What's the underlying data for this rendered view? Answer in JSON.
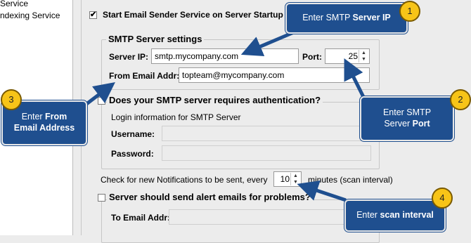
{
  "left_pane": {
    "items": [
      "Service",
      "ndexing Service"
    ]
  },
  "startup": {
    "checked": true,
    "label": "Start Email Sender Service on Server Startup"
  },
  "smtp_settings": {
    "legend": "SMTP Server settings",
    "server_ip_label": "Server IP:",
    "server_ip_value": "smtp.mycompany.com",
    "port_label": "Port:",
    "port_value": "25",
    "from_label": "From Email Addr:",
    "from_value": "topteam@mycompany.com"
  },
  "auth": {
    "checked": false,
    "label": "Does your SMTP server requires authentication?",
    "login_info": "Login information for SMTP Server",
    "username_label": "Username:",
    "username_value": "",
    "password_label": "Password:",
    "password_value": ""
  },
  "notifications": {
    "prefix": "Check for new Notifications to be sent, every",
    "interval_value": "10",
    "suffix": "minutes (scan interval)"
  },
  "alerts": {
    "checked": false,
    "label": "Server should send alert emails for problems?",
    "to_label": "To Email Addr:",
    "to_value": ""
  },
  "callouts": [
    {
      "number": "1",
      "text_plain": "Enter SMTP ",
      "text_bold": "Server IP"
    },
    {
      "number": "2",
      "line1": "Enter SMTP",
      "line2_plain": "Server ",
      "line2_bold": "Port"
    },
    {
      "number": "3",
      "line1_plain": "Enter ",
      "line1_bold": "From",
      "line2_bold": "Email Address"
    },
    {
      "number": "4",
      "text_plain": "Enter ",
      "text_bold": "scan interval"
    }
  ],
  "colors": {
    "callout_bg": "#1f4f8f",
    "badge_bg": "#f7c418",
    "arrow": "#1f4f8f"
  }
}
